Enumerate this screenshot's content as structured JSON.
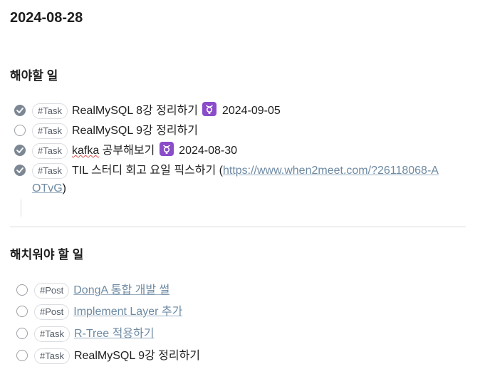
{
  "page": {
    "title": "2024-08-28"
  },
  "sections": [
    {
      "heading": "해야할 일",
      "tasks": [
        {
          "checked": true,
          "tag": "#Task",
          "text": "RealMySQL 8강 정리하기",
          "due_icon": "calendar-due-icon",
          "due": "2024-09-05"
        },
        {
          "checked": false,
          "tag": "#Task",
          "text": "RealMySQL 9강 정리하기"
        },
        {
          "checked": true,
          "tag": "#Task",
          "text_spell": "kafka",
          "text_rest": " 공부해보기",
          "due_icon": "calendar-due-icon",
          "due": "2024-08-30"
        },
        {
          "checked": true,
          "tag": "#Task",
          "text_prefix": "TIL 스터디 회고 요일 픽스하기 (",
          "link_line1": "https://www.when2meet.com/?26118068-A",
          "link_line2": "OTvG",
          "text_suffix": ")"
        }
      ]
    },
    {
      "heading": "해치워야 할 일",
      "tasks": [
        {
          "checked": false,
          "tag": "#Post",
          "link": "DongA 통합 개발 썰"
        },
        {
          "checked": false,
          "tag": "#Post",
          "link": "Implement Layer 추가"
        },
        {
          "checked": false,
          "tag": "#Task",
          "link": "R-Tree 적용하기"
        },
        {
          "checked": false,
          "tag": "#Task",
          "text": "RealMySQL 9강 정리하기"
        }
      ]
    }
  ],
  "colors": {
    "checked_fill": "#7c8794",
    "link": "#6e8aa3",
    "due_icon_bg": "#8a4cc9"
  }
}
